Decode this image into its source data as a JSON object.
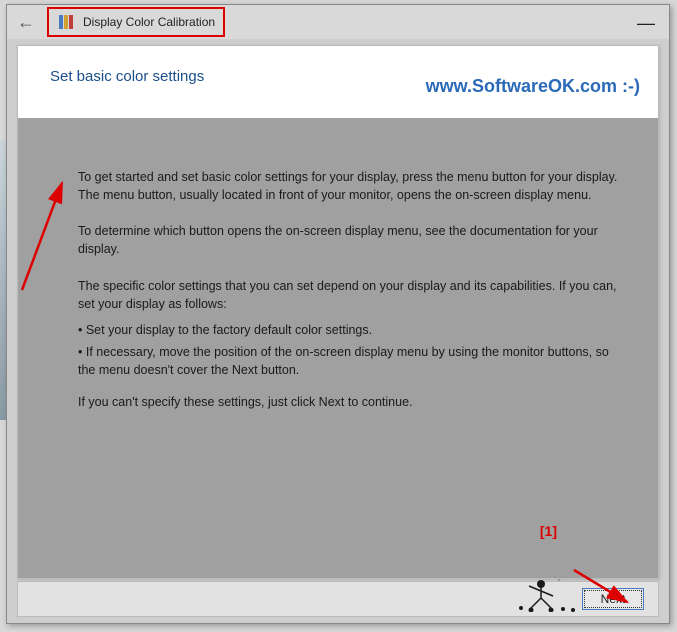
{
  "titlebar": {
    "back_glyph": "←",
    "title": "Display Color Calibration",
    "minimize_glyph": "—"
  },
  "content": {
    "heading": "Set basic color settings",
    "watermark": "www.SoftwareOK.com :-)",
    "para1": "To get started and set basic color settings for your display, press the menu button for your display. The menu button, usually located in front of your monitor, opens the on-screen display menu.",
    "para2": "To determine which button opens the on-screen display menu, see the documentation for your display.",
    "para3": "The specific color settings that you can set depend on your display and its capabilities. If you can, set your display as follows:",
    "bullet1": "• Set your display to the factory default color settings.",
    "bullet2": "• If necessary, move the position of the on-screen display menu by using the monitor buttons, so the menu doesn't cover the Next button.",
    "para4": "If you can't specify these settings,  just click Next to continue."
  },
  "footer": {
    "next_label": "Next"
  },
  "annotations": {
    "label1": "[1]"
  },
  "colors": {
    "accent": "#1a4e8a",
    "annotation": "#d00"
  }
}
